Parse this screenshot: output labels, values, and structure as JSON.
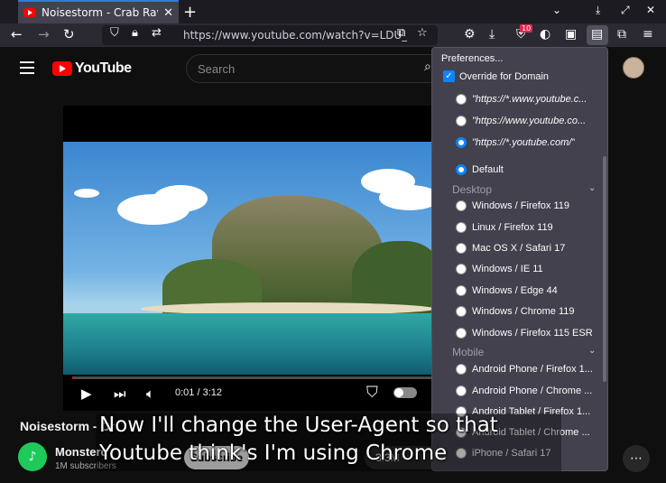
{
  "browser": {
    "tab_title": "Noisestorm - Crab Rave [",
    "url": "https://www.youtube.com/watch?v=LDU_",
    "download_badge": "10"
  },
  "youtube": {
    "logo_text": "YouTube",
    "search_placeholder": "Search",
    "video": {
      "time": "0:01 / 3:12",
      "progress": 0.005
    },
    "video_title": "Noisestorm - Cr",
    "channel_name": "Monsterc",
    "subscribers": "1M subscribers",
    "subscribe_label": "Subscribe",
    "likes": "3.3M"
  },
  "popup": {
    "preferences": "Preferences...",
    "override_label": "Override for Domain",
    "domains": [
      "\"https://*.www.youtube.c...",
      "\"https://www.youtube.co...",
      "\"https://*.youtube.com/\""
    ],
    "default_label": "Default",
    "desktop_header": "Desktop",
    "desktop_agents": [
      "Windows / Firefox 119",
      "Linux / Firefox 119",
      "Mac OS X / Safari 17",
      "Windows / IE 11",
      "Windows / Edge 44",
      "Windows / Chrome 119",
      "Windows / Firefox 115 ESR"
    ],
    "mobile_header": "Mobile",
    "mobile_agents": [
      "Android Phone / Firefox 1...",
      "Android Phone / Chrome ...",
      "Android Tablet / Firefox 1...",
      "Android Tablet / Chrome ...",
      "iPhone / Safari 17"
    ]
  },
  "caption": {
    "line1": "Now I'll change the User-Agent so that",
    "line2": "Youtube think's I'm using Chrome"
  }
}
